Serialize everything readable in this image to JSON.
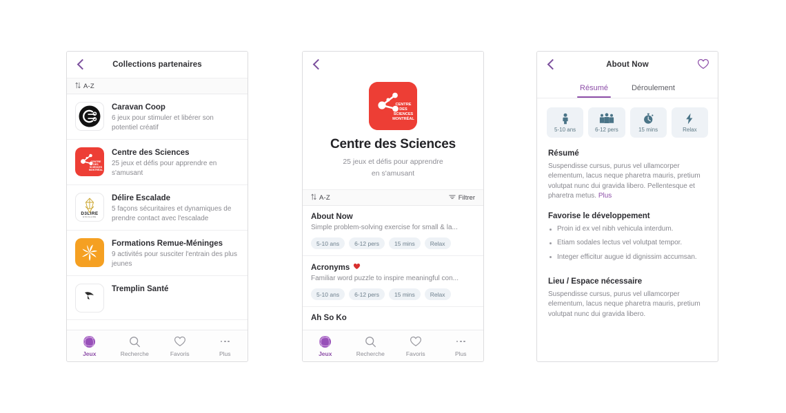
{
  "app": {
    "accent_purple": "#8d4ea8",
    "accent_teal": "#5d7985",
    "brand_red": "#ed3e35",
    "pill_bg": "#eef2f6",
    "canvas_bg": "#ffffff"
  },
  "panel_collections": {
    "header": {
      "title": "Collections partenaires",
      "back_icon": "chevron-left-icon"
    },
    "sortbar": {
      "sort_icon": "sort-arrows-icon",
      "sort_label": "A-Z"
    },
    "items": [
      {
        "title": "Caravan Coop",
        "subtitle": "6 jeux pour stimuler et libérer son potentiel créatif",
        "logo": "caravan-coop-logo",
        "logo_bg": "#111111"
      },
      {
        "title": "Centre des Sciences",
        "subtitle": "25 jeux et défis pour apprendre en s'amusant",
        "logo": "centre-des-sciences-logo",
        "logo_bg": "#ed3e35"
      },
      {
        "title": "Délire Escalade",
        "subtitle": "5 façons sécuritaires et dynamiques de prendre contact avec l'escalade",
        "logo": "delire-escalade-logo",
        "logo_bg": "#ffffff"
      },
      {
        "title": "Formations Remue-Méninges",
        "subtitle": "9 activités pour susciter l'entrain des plus jeunes",
        "logo": "formations-remue-meninges-logo",
        "logo_bg": "#f5a022"
      },
      {
        "title": "Tremplin Santé",
        "subtitle": "",
        "logo": "tremplin-sante-logo",
        "logo_bg": "#ffffff"
      }
    ]
  },
  "panel_collection_detail": {
    "header": {
      "back_icon": "chevron-left-icon"
    },
    "hero": {
      "logo": "centre-des-sciences-logo",
      "logo_caption_lines": [
        "CENTRE",
        "DES",
        "SCIENCES",
        "MONTRÉAL"
      ],
      "title": "Centre des Sciences",
      "subtitle_line1": "25 jeux et défis pour apprendre",
      "subtitle_line2": "en s'amusant"
    },
    "sortbar": {
      "sort_icon": "sort-arrows-icon",
      "sort_label": "A-Z",
      "filter_icon": "filter-icon",
      "filter_label": "Filtrer"
    },
    "games": [
      {
        "title": "About Now",
        "favorited": false,
        "description": "Simple problem-solving exercise for small & la...",
        "tags": [
          "5-10 ans",
          "6-12 pers",
          "15 mins",
          "Relax"
        ]
      },
      {
        "title": "Acronyms",
        "favorited": true,
        "heart_icon": "heart-filled-icon",
        "description": "Familiar word puzzle to inspire meaningful con...",
        "tags": [
          "5-10 ans",
          "6-12 pers",
          "15 mins",
          "Relax"
        ]
      },
      {
        "title": "Ah So Ko",
        "favorited": false,
        "description": "",
        "tags": []
      }
    ]
  },
  "panel_game_detail": {
    "header": {
      "back_icon": "chevron-left-icon",
      "title": "About Now",
      "favorite_icon": "heart-outline-icon"
    },
    "tabs": [
      {
        "label": "Résumé",
        "active": true
      },
      {
        "label": "Déroulement",
        "active": false
      }
    ],
    "info_cards": [
      {
        "icon": "person-icon",
        "label": "5-10 ans"
      },
      {
        "icon": "group-icon",
        "label": "6-12 pers"
      },
      {
        "icon": "stopwatch-icon",
        "label": "15 mins"
      },
      {
        "icon": "lightning-bolt-icon",
        "label": "Relax"
      }
    ],
    "sections": [
      {
        "heading": "Résumé",
        "type": "paragraph",
        "text": "Suspendisse cursus, purus vel ullamcorper elementum, lacus neque pharetra mauris, pretium volutpat nunc dui gravida libero. Pellentesque et pharetra metus. ",
        "more_link": "Plus"
      },
      {
        "heading": "Favorise le développement",
        "type": "list",
        "items": [
          "Proin id ex vel nibh vehicula interdum.",
          "Etiam sodales lectus vel volutpat tempor.",
          "Integer efficitur augue id dignissim accumsan."
        ]
      },
      {
        "heading": "Lieu / Espace nécessaire",
        "type": "paragraph",
        "text": "Suspendisse cursus, purus vel ullamcorper elementum, lacus neque pharetra mauris, pretium volutpat nunc dui gravida libero.",
        "more_link": ""
      }
    ]
  },
  "tabbar": {
    "items": [
      {
        "label": "Jeux",
        "icon": "games-ball-icon",
        "active": true
      },
      {
        "label": "Recherche",
        "icon": "search-icon",
        "active": false
      },
      {
        "label": "Favoris",
        "icon": "heart-outline-icon",
        "active": false
      },
      {
        "label": "Plus",
        "icon": "more-dots-icon",
        "active": false
      }
    ]
  }
}
